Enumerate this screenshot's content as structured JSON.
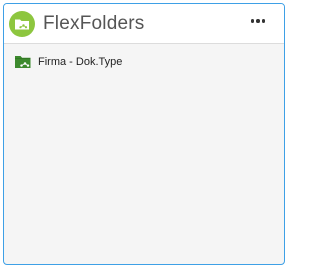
{
  "widget": {
    "title": "FlexFolders",
    "menu_icon": "more-horizontal-icon",
    "app_icon": "flexfolder-icon",
    "accent_color": "#8dc63f",
    "border_color": "#3ea0e6"
  },
  "folders": [
    {
      "label": "Firma - Dok.Type",
      "icon": "shared-folder-icon",
      "icon_color": "#3d8a2e"
    }
  ]
}
